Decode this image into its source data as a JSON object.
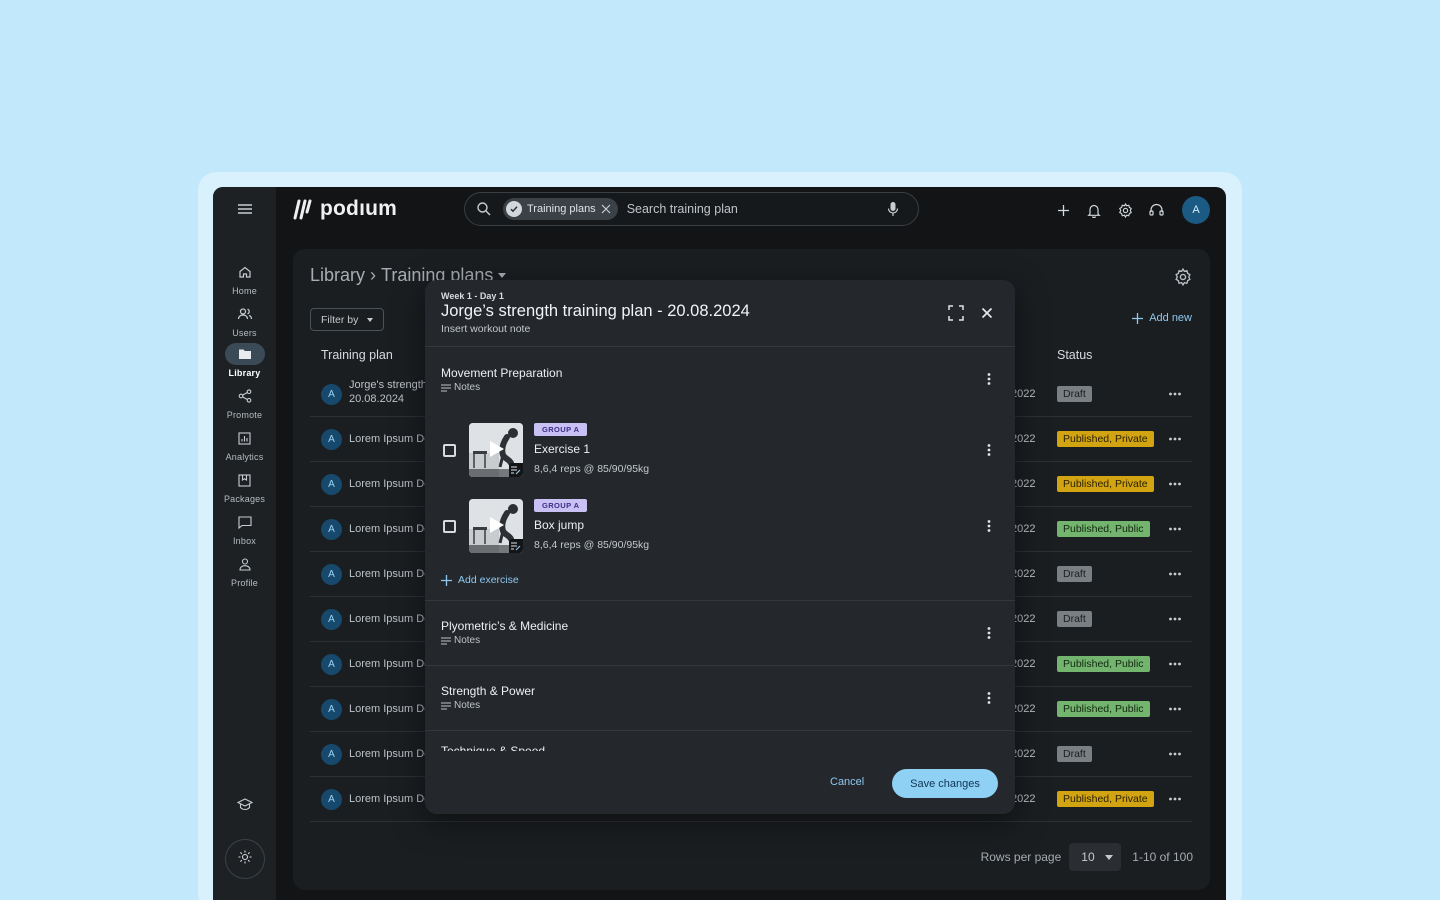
{
  "app": {
    "logo_text": "podıum",
    "avatar_initial": "A"
  },
  "sidebar": {
    "items": [
      {
        "label": "Home",
        "icon": "home-icon"
      },
      {
        "label": "Users",
        "icon": "users-icon"
      },
      {
        "label": "Library",
        "icon": "folder-icon",
        "active": true
      },
      {
        "label": "Promote",
        "icon": "share-icon"
      },
      {
        "label": "Analytics",
        "icon": "analytics-icon"
      },
      {
        "label": "Packages",
        "icon": "packages-icon"
      },
      {
        "label": "Inbox",
        "icon": "inbox-icon"
      },
      {
        "label": "Profile",
        "icon": "profile-icon"
      }
    ]
  },
  "search": {
    "chip_label": "Training plans",
    "placeholder": "Search training plan",
    "value": ""
  },
  "main": {
    "breadcrumb": {
      "root": "Library",
      "separator": "›",
      "current": "Training plans"
    },
    "filter_label": "Filter by",
    "add_new_label": "Add new",
    "columns": {
      "plan": "Training plan",
      "status": "Status"
    },
    "rows": [
      {
        "initial": "A",
        "name": "Jorge's strength training plan",
        "name_line2": "20.08.2024",
        "date": "2022",
        "status": "Draft",
        "status_type": "draft"
      },
      {
        "initial": "A",
        "name": "Lorem Ipsum Dolor",
        "date": "2022",
        "status": "Published, Private",
        "status_type": "pubpriv"
      },
      {
        "initial": "A",
        "name": "Lorem Ipsum Dolor",
        "date": "2022",
        "status": "Published, Private",
        "status_type": "pubpriv"
      },
      {
        "initial": "A",
        "name": "Lorem Ipsum Dolor",
        "date": "2022",
        "status": "Published, Public",
        "status_type": "pubpub"
      },
      {
        "initial": "A",
        "name": "Lorem Ipsum Dolor",
        "date": "2022",
        "status": "Draft",
        "status_type": "draft"
      },
      {
        "initial": "A",
        "name": "Lorem Ipsum Dolor",
        "date": "2022",
        "status": "Draft",
        "status_type": "draft"
      },
      {
        "initial": "A",
        "name": "Lorem Ipsum Dolor",
        "date": "2022",
        "status": "Published, Public",
        "status_type": "pubpub"
      },
      {
        "initial": "A",
        "name": "Lorem Ipsum Dolor",
        "date": "2022",
        "status": "Published, Public",
        "status_type": "pubpub"
      },
      {
        "initial": "A",
        "name": "Lorem Ipsum Dolor",
        "date": "2022",
        "status": "Draft",
        "status_type": "draft"
      },
      {
        "initial": "A",
        "name": "Lorem Ipsum Dolor",
        "date": "2022",
        "status": "Published, Private",
        "status_type": "pubpriv"
      }
    ],
    "pagination": {
      "rows_per_page_label": "Rows per page",
      "rows_per_page": "10",
      "range": "1-10 of 100"
    }
  },
  "modal": {
    "eyebrow": "Week 1 - Day 1",
    "title": "Jorge’s strength training plan - 20.08.2024",
    "subtitle": "Insert workout note",
    "sections": [
      {
        "title": "Movement Preparation",
        "notes": "Notes",
        "exercises": [
          {
            "group": "GROUP A",
            "name": "Exercise 1",
            "detail": "8,6,4 reps @ 85/90/95kg"
          },
          {
            "group": "GROUP A",
            "name": "Box jump",
            "detail": "8,6,4 reps @ 85/90/95kg"
          }
        ],
        "add_exercise_label": "Add exercise"
      },
      {
        "title": "Plyometric’s & Medicine",
        "notes": "Notes"
      },
      {
        "title": "Strength & Power",
        "notes": "Notes"
      }
    ],
    "partial_section_title": "Technique & Speed",
    "cancel_label": "Cancel",
    "save_label": "Save changes"
  },
  "colors": {
    "accent": "#8fd0f5",
    "background": "#c2e9fb",
    "draft": "#7a7f84",
    "published_private": "#d3a411",
    "published_public": "#73b56f",
    "group_tag": "#c9c0f3"
  }
}
